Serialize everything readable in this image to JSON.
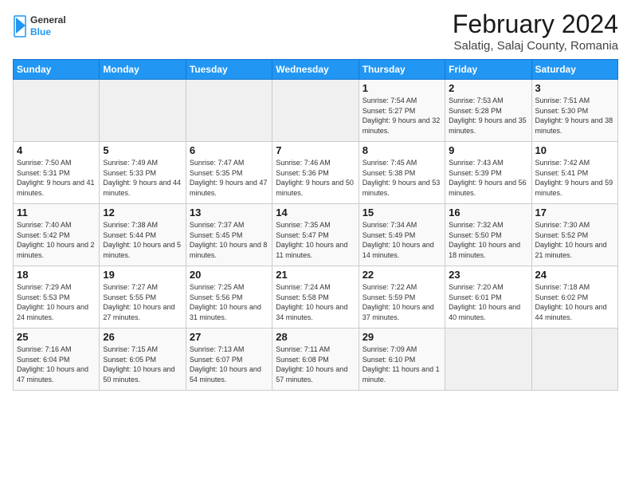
{
  "header": {
    "logo_general": "General",
    "logo_blue": "Blue",
    "month_title": "February 2024",
    "subtitle": "Salatig, Salaj County, Romania"
  },
  "days_of_week": [
    "Sunday",
    "Monday",
    "Tuesday",
    "Wednesday",
    "Thursday",
    "Friday",
    "Saturday"
  ],
  "weeks": [
    [
      {
        "day": "",
        "info": ""
      },
      {
        "day": "",
        "info": ""
      },
      {
        "day": "",
        "info": ""
      },
      {
        "day": "",
        "info": ""
      },
      {
        "day": "1",
        "info": "Sunrise: 7:54 AM\nSunset: 5:27 PM\nDaylight: 9 hours\nand 32 minutes."
      },
      {
        "day": "2",
        "info": "Sunrise: 7:53 AM\nSunset: 5:28 PM\nDaylight: 9 hours\nand 35 minutes."
      },
      {
        "day": "3",
        "info": "Sunrise: 7:51 AM\nSunset: 5:30 PM\nDaylight: 9 hours\nand 38 minutes."
      }
    ],
    [
      {
        "day": "4",
        "info": "Sunrise: 7:50 AM\nSunset: 5:31 PM\nDaylight: 9 hours\nand 41 minutes."
      },
      {
        "day": "5",
        "info": "Sunrise: 7:49 AM\nSunset: 5:33 PM\nDaylight: 9 hours\nand 44 minutes."
      },
      {
        "day": "6",
        "info": "Sunrise: 7:47 AM\nSunset: 5:35 PM\nDaylight: 9 hours\nand 47 minutes."
      },
      {
        "day": "7",
        "info": "Sunrise: 7:46 AM\nSunset: 5:36 PM\nDaylight: 9 hours\nand 50 minutes."
      },
      {
        "day": "8",
        "info": "Sunrise: 7:45 AM\nSunset: 5:38 PM\nDaylight: 9 hours\nand 53 minutes."
      },
      {
        "day": "9",
        "info": "Sunrise: 7:43 AM\nSunset: 5:39 PM\nDaylight: 9 hours\nand 56 minutes."
      },
      {
        "day": "10",
        "info": "Sunrise: 7:42 AM\nSunset: 5:41 PM\nDaylight: 9 hours\nand 59 minutes."
      }
    ],
    [
      {
        "day": "11",
        "info": "Sunrise: 7:40 AM\nSunset: 5:42 PM\nDaylight: 10 hours\nand 2 minutes."
      },
      {
        "day": "12",
        "info": "Sunrise: 7:38 AM\nSunset: 5:44 PM\nDaylight: 10 hours\nand 5 minutes."
      },
      {
        "day": "13",
        "info": "Sunrise: 7:37 AM\nSunset: 5:45 PM\nDaylight: 10 hours\nand 8 minutes."
      },
      {
        "day": "14",
        "info": "Sunrise: 7:35 AM\nSunset: 5:47 PM\nDaylight: 10 hours\nand 11 minutes."
      },
      {
        "day": "15",
        "info": "Sunrise: 7:34 AM\nSunset: 5:49 PM\nDaylight: 10 hours\nand 14 minutes."
      },
      {
        "day": "16",
        "info": "Sunrise: 7:32 AM\nSunset: 5:50 PM\nDaylight: 10 hours\nand 18 minutes."
      },
      {
        "day": "17",
        "info": "Sunrise: 7:30 AM\nSunset: 5:52 PM\nDaylight: 10 hours\nand 21 minutes."
      }
    ],
    [
      {
        "day": "18",
        "info": "Sunrise: 7:29 AM\nSunset: 5:53 PM\nDaylight: 10 hours\nand 24 minutes."
      },
      {
        "day": "19",
        "info": "Sunrise: 7:27 AM\nSunset: 5:55 PM\nDaylight: 10 hours\nand 27 minutes."
      },
      {
        "day": "20",
        "info": "Sunrise: 7:25 AM\nSunset: 5:56 PM\nDaylight: 10 hours\nand 31 minutes."
      },
      {
        "day": "21",
        "info": "Sunrise: 7:24 AM\nSunset: 5:58 PM\nDaylight: 10 hours\nand 34 minutes."
      },
      {
        "day": "22",
        "info": "Sunrise: 7:22 AM\nSunset: 5:59 PM\nDaylight: 10 hours\nand 37 minutes."
      },
      {
        "day": "23",
        "info": "Sunrise: 7:20 AM\nSunset: 6:01 PM\nDaylight: 10 hours\nand 40 minutes."
      },
      {
        "day": "24",
        "info": "Sunrise: 7:18 AM\nSunset: 6:02 PM\nDaylight: 10 hours\nand 44 minutes."
      }
    ],
    [
      {
        "day": "25",
        "info": "Sunrise: 7:16 AM\nSunset: 6:04 PM\nDaylight: 10 hours\nand 47 minutes."
      },
      {
        "day": "26",
        "info": "Sunrise: 7:15 AM\nSunset: 6:05 PM\nDaylight: 10 hours\nand 50 minutes."
      },
      {
        "day": "27",
        "info": "Sunrise: 7:13 AM\nSunset: 6:07 PM\nDaylight: 10 hours\nand 54 minutes."
      },
      {
        "day": "28",
        "info": "Sunrise: 7:11 AM\nSunset: 6:08 PM\nDaylight: 10 hours\nand 57 minutes."
      },
      {
        "day": "29",
        "info": "Sunrise: 7:09 AM\nSunset: 6:10 PM\nDaylight: 11 hours\nand 1 minute."
      },
      {
        "day": "",
        "info": ""
      },
      {
        "day": "",
        "info": ""
      }
    ]
  ]
}
